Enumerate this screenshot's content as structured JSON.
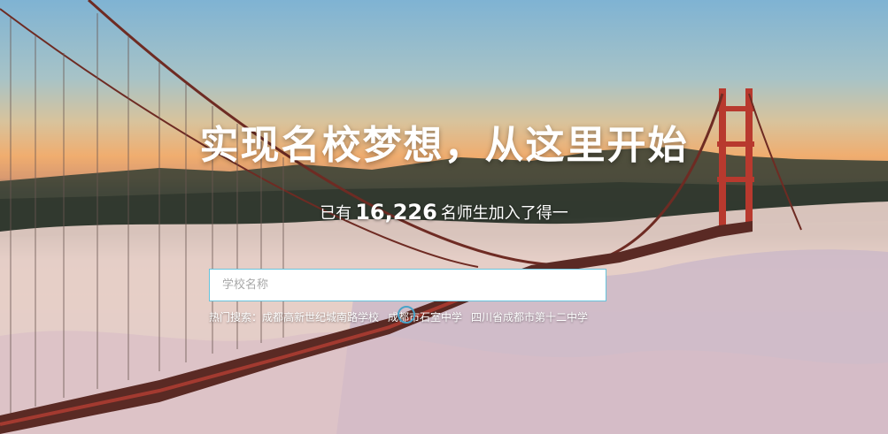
{
  "hero": {
    "headline": "实现名校梦想，从这里开始",
    "sub_prefix": "已有",
    "teacher_count": "16,226",
    "sub_suffix": "名师生加入了得一"
  },
  "search": {
    "placeholder": "学校名称",
    "value": ""
  },
  "hot_search": {
    "label": "热门搜索：",
    "items": [
      "成都高新世纪城南路学校",
      "成都市石室中学",
      "四川省成都市第十二中学"
    ]
  },
  "colors": {
    "input_border": "#67c3dc",
    "text": "#ffffff",
    "bridge": "#b8392e"
  },
  "background": {
    "icon": "golden-gate-bridge-fog-photo"
  }
}
